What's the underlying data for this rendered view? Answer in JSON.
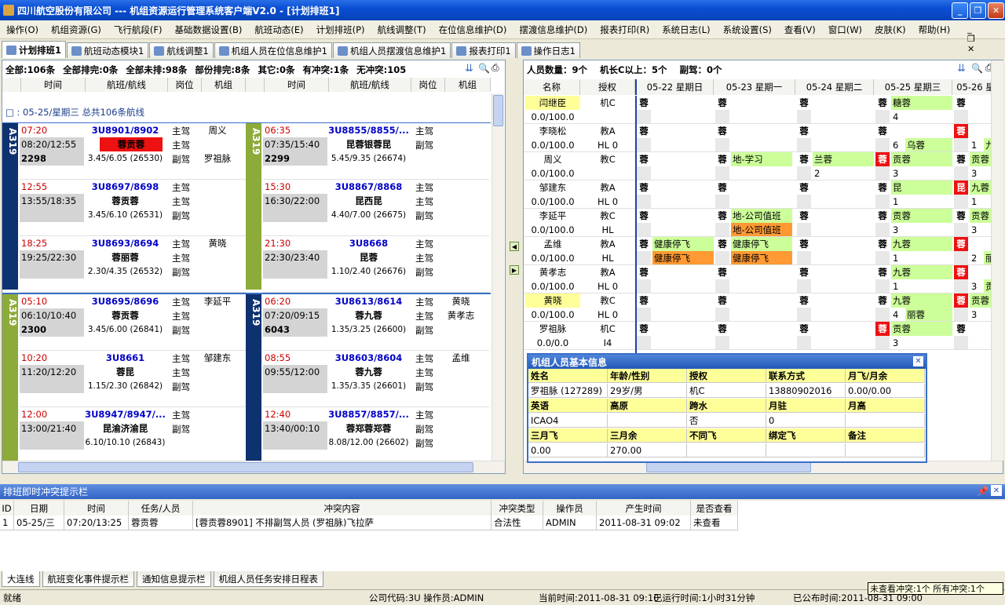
{
  "window": {
    "title": "四川航空股份有限公司 --- 机组资源运行管理系统客户端V2.0 - [计划排班1]"
  },
  "menu": [
    "操作(O)",
    "机组资源(G)",
    "飞行航段(F)",
    "基础数据设置(B)",
    "航班动态(E)",
    "计划排班(P)",
    "航线调整(T)",
    "在位信息维护(D)",
    "摆渡信息维护(D)",
    "报表打印(R)",
    "系统日志(L)",
    "系统设置(S)",
    "查看(V)",
    "窗口(W)",
    "皮肤(K)",
    "帮助(H)"
  ],
  "tabs": [
    "计划排班1",
    "航班动态模块1",
    "航线调整1",
    "机组人员在位信息维护1",
    "机组人员摆渡信息维护1",
    "报表打印1",
    "操作日志1"
  ],
  "left": {
    "summary": [
      "全部:106条",
      "全部排完:0条",
      "全部未排:98条",
      "部份排完:8条",
      "其它:0条",
      "有冲突:1条",
      "无冲突:105"
    ],
    "headers": [
      "时间",
      "航班/航线",
      "岗位",
      "机组",
      "时间",
      "航班/航线",
      "岗位",
      "机组"
    ],
    "group": "□ : 05-25/星期三   总共106条航线",
    "columns": [
      {
        "aircraft": "A319",
        "color": "navy",
        "flights": [
          {
            "t1": "07:20",
            "t2": "08:20/12:55",
            "t3": "2298",
            "no": "3U8901/8902",
            "route": "蓉贡蓉",
            "route_red": true,
            "stat": "3.45/6.05 (26530)",
            "roles": [
              "主驾",
              "主驾",
              "副驾"
            ],
            "crew": [
              "周义",
              "",
              "罗祖脉"
            ]
          },
          {
            "t1": "12:55",
            "t2": "13:55/18:35",
            "t3": "",
            "no": "3U8697/8698",
            "route": "蓉贡蓉",
            "stat": "3.45/6.10 (26531)",
            "roles": [
              "主驾",
              "主驾",
              "副驾"
            ],
            "crew": [
              "",
              "",
              ""
            ]
          },
          {
            "t1": "18:25",
            "t2": "19:25/22:30",
            "t3": "",
            "no": "3U8693/8694",
            "route": "蓉丽蓉",
            "stat": "2.30/4.35 (26532)",
            "roles": [
              "主驾",
              "主驾",
              "副驾"
            ],
            "crew": [
              "黄晓",
              "",
              ""
            ]
          }
        ]
      },
      {
        "aircraft": "A319",
        "color": "olive",
        "flights": [
          {
            "t1": "05:10",
            "t2": "06:10/10:40",
            "t3": "2300",
            "no": "3U8695/8696",
            "route": "蓉贡蓉",
            "stat": "3.45/6.00 (26841)",
            "roles": [
              "主驾",
              "主驾",
              "副驾"
            ],
            "crew": [
              "李延平",
              "",
              ""
            ]
          },
          {
            "t1": "10:20",
            "t2": "11:20/12:20",
            "t3": "",
            "no": "3U8661",
            "route": "蓉昆",
            "stat": "1.15/2.30 (26842)",
            "roles": [
              "主驾",
              "主驾",
              "副驾"
            ],
            "crew": [
              "邹建东",
              "",
              ""
            ]
          },
          {
            "t1": "12:00",
            "t2": "13:00/21:40",
            "t3": "",
            "no": "3U8947/8947/...",
            "route": "昆渝济渝昆",
            "stat": "6.10/10.10 (26843)",
            "roles": [
              "主驾",
              "副驾",
              ""
            ],
            "crew": [
              "",
              "",
              ""
            ]
          }
        ]
      },
      {
        "aircraft": "A319",
        "color": "olive",
        "flights": [
          {
            "t1": "06:35",
            "t2": "07:35/15:40",
            "t3": "2299",
            "no": "3U8855/8855/...",
            "route": "昆蓉银蓉昆",
            "stat": "5.45/9.35 (26674)",
            "roles": [
              "主驾",
              "副驾",
              ""
            ],
            "crew": [
              "",
              "",
              ""
            ]
          },
          {
            "t1": "15:30",
            "t2": "16:30/22:00",
            "t3": "",
            "no": "3U8867/8868",
            "route": "昆西昆",
            "stat": "4.40/7.00 (26675)",
            "roles": [
              "主驾",
              "主驾",
              "副驾"
            ],
            "crew": [
              "",
              "",
              ""
            ]
          },
          {
            "t1": "21:30",
            "t2": "22:30/23:40",
            "t3": "",
            "no": "3U8668",
            "route": "昆蓉",
            "stat": "1.10/2.40 (26676)",
            "roles": [
              "主驾",
              "主驾",
              "副驾"
            ],
            "crew": [
              "",
              "",
              ""
            ]
          }
        ]
      },
      {
        "aircraft": "A319",
        "color": "navy",
        "flights": [
          {
            "t1": "06:20",
            "t2": "07:20/09:15",
            "t3": "6043",
            "no": "3U8613/8614",
            "route": "蓉九蓉",
            "stat": "1.35/3.25 (26600)",
            "roles": [
              "主驾",
              "主驾",
              "副驾"
            ],
            "crew": [
              "黄晓",
              "黄孝志",
              ""
            ]
          },
          {
            "t1": "08:55",
            "t2": "09:55/12:00",
            "t3": "",
            "no": "3U8603/8604",
            "route": "蓉九蓉",
            "stat": "1.35/3.35 (26601)",
            "roles": [
              "主驾",
              "主驾",
              "副驾"
            ],
            "crew": [
              "孟维",
              "",
              ""
            ]
          },
          {
            "t1": "12:40",
            "t2": "13:40/00:10",
            "t3": "",
            "no": "3U8857/8857/...",
            "route": "蓉郑蓉郑蓉",
            "stat": "8.08/12.00 (26602)",
            "roles": [
              "主驾",
              "副驾",
              "副驾"
            ],
            "crew": [
              "",
              "",
              ""
            ]
          }
        ]
      }
    ]
  },
  "right": {
    "summary": [
      "人员数量：9个",
      "机长C以上：5个",
      "副驾：0个"
    ],
    "headers": [
      "名称",
      "授权",
      "05-22 星期日",
      "05-23 星期一",
      "05-24 星期二",
      "05-25 星期三",
      "05-26 星"
    ],
    "people": [
      {
        "name": "闫继臣",
        "name_hl": true,
        "auth": "机C",
        "hours": "0.0/100.0",
        "sub": "",
        "cells": [
          [
            "蓉",
            ""
          ],
          [
            "蓉",
            ""
          ],
          [
            "蓉",
            ""
          ],
          [
            "蓉",
            "糖蓉",
            "4",
            ""
          ],
          [
            "蓉",
            ""
          ]
        ]
      },
      {
        "name": "李晓松",
        "auth": "教A",
        "hours": "0.0/100.0",
        "sub": "HL 0",
        "cells": [
          [
            "蓉",
            ""
          ],
          [
            "蓉",
            ""
          ],
          [
            "蓉",
            ""
          ],
          [
            "蓉",
            "",
            "6",
            "乌蓉"
          ],
          [
            "蓉r",
            "",
            "1",
            "九蓉"
          ]
        ]
      },
      {
        "name": "周义",
        "auth": "教C",
        "hours": "0.0/100.0",
        "sub": "",
        "cells": [
          [
            "蓉",
            ""
          ],
          [
            "蓉",
            "地-学习"
          ],
          [
            "蓉",
            "兰蓉",
            "2",
            ""
          ],
          [
            "蓉r",
            "贡蓉",
            "3",
            ""
          ],
          [
            "蓉",
            "贡蓉",
            "3",
            ""
          ]
        ]
      },
      {
        "name": "邹建东",
        "auth": "教A",
        "hours": "0.0/100.0",
        "sub": "HL 0",
        "cells": [
          [
            "蓉",
            ""
          ],
          [
            "蓉",
            ""
          ],
          [
            "蓉",
            ""
          ],
          [
            "蓉",
            "昆",
            "1",
            ""
          ],
          [
            "昆r",
            "九蓉",
            "1",
            ""
          ]
        ]
      },
      {
        "name": "李延平",
        "auth": "教C",
        "hours": "0.0/100.0",
        "sub": "HL",
        "cells": [
          [
            "蓉",
            ""
          ],
          [
            "蓉",
            "地-公司值班",
            "",
            "地-公司值班"
          ],
          [
            "蓉",
            ""
          ],
          [
            "蓉",
            "贡蓉",
            "3",
            ""
          ],
          [
            "蓉",
            "贡蓉",
            "3",
            ""
          ]
        ]
      },
      {
        "name": "孟维",
        "auth": "教A",
        "hours": "0.0/100.0",
        "sub": "HL",
        "cells": [
          [
            "蓉",
            "健康停飞",
            "",
            "健康停飞"
          ],
          [
            "蓉",
            "健康停飞",
            "",
            "健康停飞"
          ],
          [
            "蓉",
            ""
          ],
          [
            "蓉",
            "九蓉",
            "1",
            ""
          ],
          [
            "蓉r",
            "",
            "2",
            "丽蓉"
          ]
        ]
      },
      {
        "name": "黄孝志",
        "auth": "教A",
        "hours": "0.0/100.0",
        "sub": "HL 0",
        "cells": [
          [
            "蓉",
            ""
          ],
          [
            "蓉",
            ""
          ],
          [
            "蓉",
            ""
          ],
          [
            "蓉",
            "九蓉",
            "1",
            ""
          ],
          [
            "蓉r",
            "",
            "3",
            "贡蓉"
          ]
        ]
      },
      {
        "name": "黄晓",
        "name_hl": true,
        "auth": "教C",
        "hours": "0.0/100.0",
        "sub": "HL 0",
        "cells": [
          [
            "蓉",
            ""
          ],
          [
            "蓉",
            ""
          ],
          [
            "蓉",
            ""
          ],
          [
            "蓉",
            "九蓉",
            "4",
            "丽蓉"
          ],
          [
            "蓉r",
            "贡蓉",
            "3",
            ""
          ]
        ]
      },
      {
        "name": "罗祖脉",
        "auth": "机C",
        "hours": "0.0/0.0",
        "sub": "I4",
        "cells": [
          [
            "蓉",
            ""
          ],
          [
            "蓉",
            ""
          ],
          [
            "蓉",
            ""
          ],
          [
            "蓉r",
            "贡蓉",
            "3",
            ""
          ],
          [
            "蓉",
            ""
          ]
        ]
      }
    ]
  },
  "info": {
    "title": "机组人员基本信息",
    "h1": [
      "姓名",
      "年龄/性别",
      "授权",
      "联系方式",
      "月飞/月余"
    ],
    "r1": [
      "罗祖脉 (127289)",
      "29岁/男",
      "机C",
      "13880902016",
      "0.00/0.00"
    ],
    "h2": [
      "英语",
      "高原",
      "跨水",
      "月驻",
      "月高"
    ],
    "r2": [
      "ICAO4",
      "",
      "否",
      "0",
      ""
    ],
    "h3": [
      "三月飞",
      "三月余",
      "不同飞",
      "绑定飞",
      "备注"
    ],
    "r3": [
      "0.00",
      "270.00",
      "",
      "",
      ""
    ]
  },
  "conflict": {
    "title": "排班即时冲突提示栏",
    "headers": [
      "ID",
      "日期",
      "时间",
      "任务/人员",
      "冲突内容",
      "冲突类型",
      "操作员",
      "产生时间",
      "是否查看"
    ],
    "rows": [
      [
        "1",
        "05-25/三",
        "07:20/13:25",
        "蓉贡蓉",
        "[蓉贡蓉8901] 不排副驾人员 (罗祖脉)飞拉萨",
        "合法性",
        "ADMIN",
        "2011-08-31 09:02",
        "未查看"
      ]
    ]
  },
  "bottom_tabs": [
    "大连线",
    "航班变化事件提示栏",
    "通知信息提示栏",
    "机组人员任务安排日程表"
  ],
  "status": {
    "left": "就绪",
    "company": "公司代码:3U 操作员:ADMIN",
    "time": "当前时间:2011-08-31 09:10",
    "run": "已运行时间:1小时31分钟",
    "pub": "已公布时间:2011-08-31 09:00",
    "popup": "未查看冲突:1个  所有冲突:1个"
  }
}
